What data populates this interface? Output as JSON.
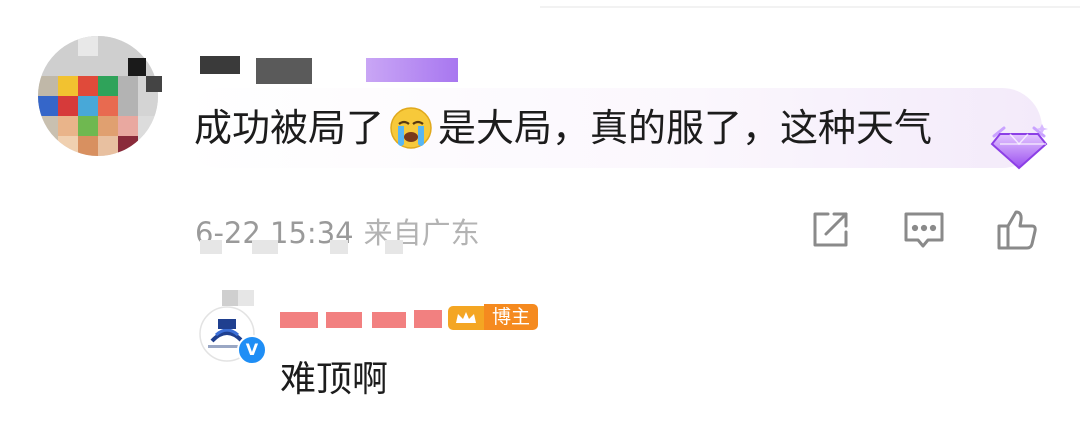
{
  "comment": {
    "text_before": "成功被局了",
    "emoji": "crying-face",
    "text_after": "是大局，真的服了，这种天气",
    "badge": "purple-gem-badge",
    "timestamp": "6-22 15:34",
    "location": "来自广东"
  },
  "actions": {
    "share": "share-icon",
    "comment": "comment-icon",
    "like": "like-icon"
  },
  "reply": {
    "tag_label": "博主",
    "text": "难顶啊",
    "verified_symbol": "V"
  },
  "colors": {
    "meta_text": "#9a9a9a",
    "badge_orange": "#f58a1f",
    "verified_blue": "#1f8ef5",
    "gem_purple": "#a35cf0"
  }
}
